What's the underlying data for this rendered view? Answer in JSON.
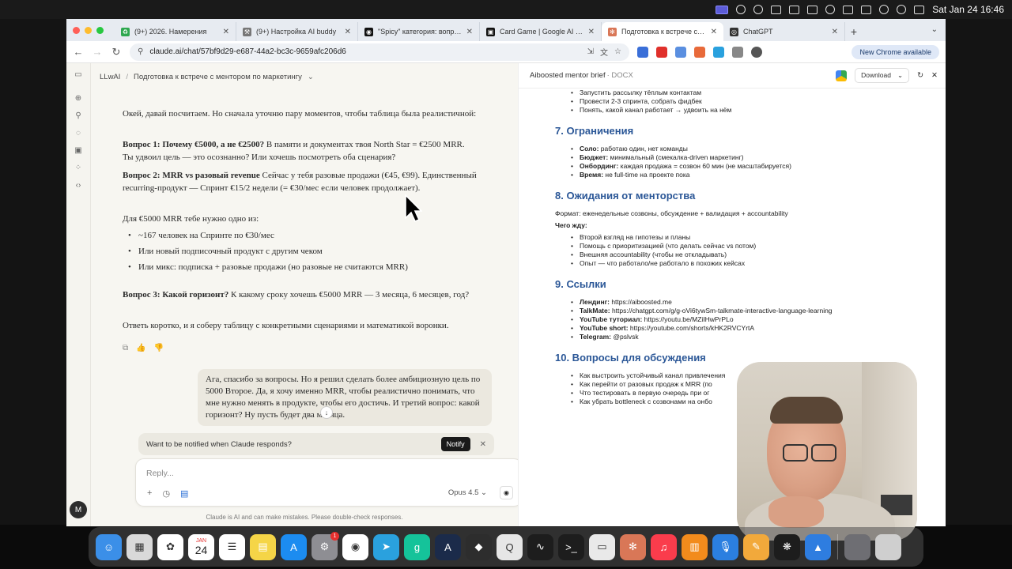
{
  "menubar": {
    "datetime": "Sat Jan 24  16:46"
  },
  "tabs": [
    {
      "label": "(9+) 2026. Намерения",
      "color": "#2fa84f",
      "glyph": "♻"
    },
    {
      "label": "(9+) Настройка AI buddy",
      "color": "#777777",
      "glyph": "⚒"
    },
    {
      "label": "\"Spicy\" категория: вопросы",
      "color": "#111111",
      "glyph": "◉"
    },
    {
      "label": "Card Game | Google AI Studio",
      "color": "#111111",
      "glyph": "▣"
    },
    {
      "label": "Подготовка к встрече с мен",
      "color": "#d97757",
      "glyph": "✻"
    },
    {
      "label": "ChatGPT",
      "color": "#333333",
      "glyph": "◎"
    }
  ],
  "address": {
    "url": "claude.ai/chat/57bf9d29-e687-44a2-bc3c-9659afc206d6",
    "new_chrome": "New Chrome available"
  },
  "chat": {
    "breadcrumb_project": "LLwAI",
    "breadcrumb_title": "Подготовка к встрече с ментором по маркетингу",
    "intro": "Окей, давай посчитаем. Но сначала уточню пару моментов, чтобы таблица была реалистичной:",
    "q1_title": "Вопрос 1: Почему €5000, а не €2500?",
    "q1_text": " В памяти и документах твоя North Star = €2500 MRR. Ты удвоил цель — это осознанно? Или хочешь посмотреть оба сценария?",
    "q2_title": "Вопрос 2: MRR vs разовый revenue",
    "q2_text": " Сейчас у тебя разовые продажи (€45, €99). Единственный recurring-продукт — Спринт €15/2 недели (= €30/мес если человек продолжает).",
    "need_text": "Для €5000 MRR тебе нужно одно из:",
    "options": [
      "~167 человек на Спринте по €30/мес",
      "Или новый подписочный продукт с другим чеком",
      "Или микс: подписка + разовые продажи (но разовые не считаются MRR)"
    ],
    "q3_title": "Вопрос 3: Какой горизонт?",
    "q3_text": " К какому сроку хочешь €5000 MRR — 3 месяца, 6 месяцев, год?",
    "closing": "Ответь коротко, и я соберу таблицу с конкретными сценариями и математикой воронки.",
    "user_message": "Ага, спасибо за вопросы. Но я решил сделать более амбициозную цель по 5000 Второе. Да, я хочу именно MRR, чтобы реалистично понимать, что мне нужно менять в продукте, чтобы его достичь. И третий вопрос: какой горизонт? Ну пусть будет два месяца.",
    "notify_text": "Want to be notified when Claude responds?",
    "notify_button": "Notify",
    "reply_placeholder": "Reply...",
    "model": "Opus 4.5",
    "disclaimer": "Claude is AI and can make mistakes. Please double-check responses."
  },
  "document": {
    "title": "Aiboosted mentor brief",
    "type": "· DOCX",
    "download": "Download",
    "top_items": [
      "Запустить рассылку тёплым контактам",
      "Провести 2-3 спринта, собрать фидбек",
      "Понять, какой канал работает → удвоить на нём"
    ],
    "s7_title": "7. Ограничения",
    "s7_items": [
      {
        "k": "Соло:",
        "v": " работаю один, нет команды"
      },
      {
        "k": "Бюджет:",
        "v": " минимальный (смекалка-driven маркетинг)"
      },
      {
        "k": "Онбординг:",
        "v": " каждая продажа = созвон 60 мин (не масштабируется)"
      },
      {
        "k": "Время:",
        "v": " не full-time на проекте пока"
      }
    ],
    "s8_title": "8. Ожидания от менторства",
    "s8_format": "Формат: еженедельные созвоны, обсуждение + валидация + accountability",
    "s8_sub": "Чего жду:",
    "s8_items": [
      "Второй взгляд на гипотезы и планы",
      "Помощь с приоритизацией (что делать сейчас vs потом)",
      "Внешняя accountability (чтобы не откладывать)",
      "Опыт — что работало/не работало в похожих кейсах"
    ],
    "s9_title": "9. Ссылки",
    "s9_items": [
      {
        "k": "Лендинг:",
        "v": " https://aiboosted.me"
      },
      {
        "k": "TalkMate:",
        "v": " https://chatgpt.com/g/g-oVi6tywSm-talkmate-interactive-language-learning"
      },
      {
        "k": "YouTube туториал:",
        "v": " https://youtu.be/MZiIHwPrPLo"
      },
      {
        "k": "YouTube short:",
        "v": " https://youtube.com/shorts/kHK2RVCYrtA"
      },
      {
        "k": "Telegram:",
        "v": " @pslvsk"
      }
    ],
    "s10_title": "10. Вопросы для обсуждения",
    "s10_items": [
      "Как выстроить устойчивый канал привлечения",
      "Как перейти от разовых продаж к MRR (по",
      "Что тестировать в первую очередь при ог",
      "Как убрать bottleneck с созвонами на онбо"
    ]
  },
  "dock": {
    "calendar_month": "JAN",
    "calendar_day": "24",
    "settings_badge": "1",
    "icons": [
      {
        "name": "finder-icon",
        "color": "#3b8fe8",
        "glyph": "☺"
      },
      {
        "name": "launchpad-icon",
        "color": "#d9d9d9",
        "glyph": "▦"
      },
      {
        "name": "photos-icon",
        "color": "#ffffff",
        "glyph": "✿"
      },
      {
        "name": "calendar-icon",
        "color": "#ffffff",
        "glyph": ""
      },
      {
        "name": "reminders-icon",
        "color": "#ffffff",
        "glyph": "☰"
      },
      {
        "name": "notes-icon",
        "color": "#f5d547",
        "glyph": "▤"
      },
      {
        "name": "app-store-icon",
        "color": "#1c8cf0",
        "glyph": "A"
      },
      {
        "name": "system-settings-icon",
        "color": "#8e8e93",
        "glyph": "⚙"
      },
      {
        "name": "chrome-icon",
        "color": "#ffffff",
        "glyph": "◉"
      },
      {
        "name": "telegram-icon",
        "color": "#2aa1de",
        "glyph": "➤"
      },
      {
        "name": "grammarly-icon",
        "color": "#15c39a",
        "glyph": "g"
      },
      {
        "name": "affinity-icon",
        "color": "#1b2b4a",
        "glyph": "A"
      },
      {
        "name": "cube-app-icon",
        "color": "#2d2d2d",
        "glyph": "◆"
      },
      {
        "name": "quicktime-icon",
        "color": "#e6e6e6",
        "glyph": "Q"
      },
      {
        "name": "activity-monitor-icon",
        "color": "#1d1d1d",
        "glyph": "∿"
      },
      {
        "name": "terminal-icon",
        "color": "#1d1d1d",
        "glyph": ">_"
      },
      {
        "name": "preview-icon",
        "color": "#e9e9e9",
        "glyph": "▭"
      },
      {
        "name": "claude-icon",
        "color": "#d97757",
        "glyph": "✻"
      },
      {
        "name": "music-icon",
        "color": "#fa3c4c",
        "glyph": "♫"
      },
      {
        "name": "books-icon",
        "color": "#f28b1c",
        "glyph": "▥"
      },
      {
        "name": "voice-memos-icon",
        "color": "#2b7fe0",
        "glyph": "🎙"
      },
      {
        "name": "pencil-app-icon",
        "color": "#f2a93b",
        "glyph": "✎"
      },
      {
        "name": "chatgpt-icon",
        "color": "#1d1d1d",
        "glyph": "❋"
      },
      {
        "name": "keynote-icon",
        "color": "#2e7de0",
        "glyph": "▲"
      }
    ]
  }
}
